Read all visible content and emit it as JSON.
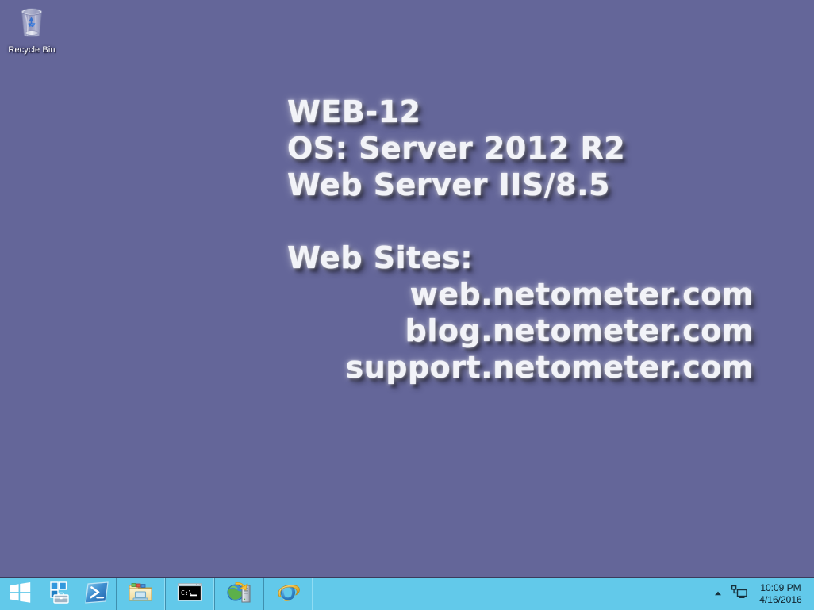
{
  "desktop": {
    "background_color": "#646699",
    "icons": [
      {
        "name": "recycle-bin",
        "label": "Recycle Bin",
        "icon": "recycle-bin-icon"
      }
    ],
    "bginfo": {
      "lines": [
        {
          "id": "hostname",
          "text": "WEB-12",
          "style": "lead"
        },
        {
          "id": "os",
          "text": "OS: Server 2012 R2",
          "style": "lead"
        },
        {
          "id": "role",
          "text": "Web Server IIS/8.5",
          "style": "lead"
        },
        {
          "id": "spacer",
          "text": "",
          "style": "blank"
        },
        {
          "id": "sites-title",
          "text": "Web Sites:",
          "style": "head"
        },
        {
          "id": "site-1",
          "text": "web.netometer.com",
          "style": "site"
        },
        {
          "id": "site-2",
          "text": "blog.netometer.com",
          "style": "site"
        },
        {
          "id": "site-3",
          "text": "support.netometer.com",
          "style": "site"
        }
      ],
      "text_color": "#f2f3f8"
    }
  },
  "taskbar": {
    "background_color": "#62c9ea",
    "border_color": "#3b3b5c",
    "start": {
      "label": "Start",
      "icon": "windows-logo-icon"
    },
    "pinned": [
      {
        "label": "Server Manager",
        "icon": "server-manager-icon"
      },
      {
        "label": "Windows PowerShell",
        "icon": "powershell-icon"
      }
    ],
    "apps": [
      {
        "label": "File Explorer",
        "icon": "file-explorer-icon"
      },
      {
        "label": "Command Prompt",
        "icon": "command-prompt-icon"
      },
      {
        "label": "Internet Information Services (IIS) Manager",
        "icon": "iis-manager-icon"
      },
      {
        "label": "Internet Explorer",
        "icon": "internet-explorer-icon"
      }
    ],
    "tray": {
      "show_hidden_icons": {
        "label": "Show hidden icons",
        "icon": "chevron-up-icon"
      },
      "icons": [
        {
          "label": "Network",
          "icon": "network-icon"
        }
      ],
      "clock": {
        "time": "10:09 PM",
        "date": "4/16/2016"
      }
    }
  }
}
